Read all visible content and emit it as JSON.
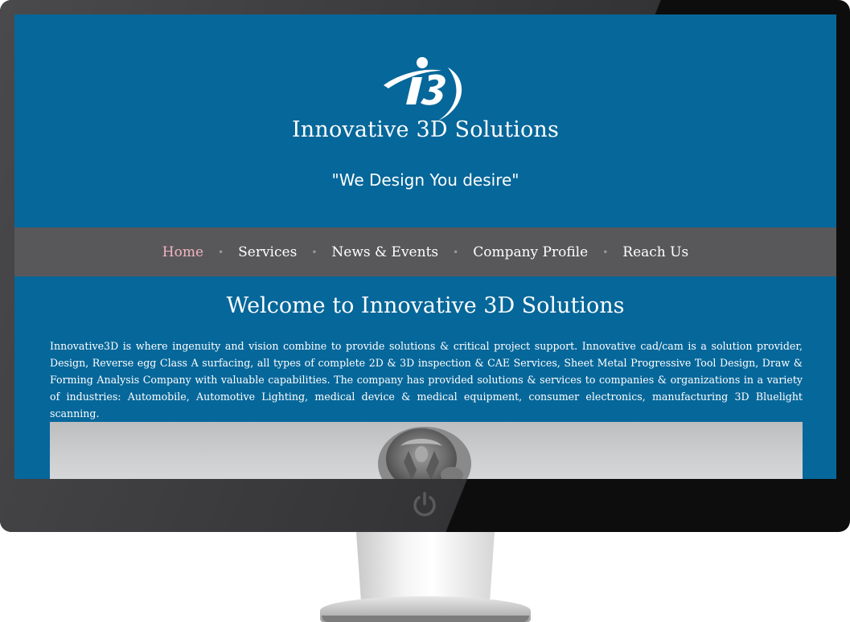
{
  "site": {
    "title": "Innovative 3D Solutions",
    "tagline": "\"We Design You desire\"",
    "logo_text": "i3"
  },
  "nav": {
    "items": [
      {
        "label": "Home",
        "active": true
      },
      {
        "label": "Services",
        "active": false
      },
      {
        "label": "News & Events",
        "active": false
      },
      {
        "label": "Company Profile",
        "active": false
      },
      {
        "label": "Reach Us",
        "active": false
      }
    ],
    "separator": "•"
  },
  "main": {
    "heading": "Welcome to Innovative 3D Solutions",
    "intro": "Innovative3D is where ingenuity and vision combine to provide solutions & critical project support. Innovative cad/cam is a solution provider, Design, Reverse egg Class A surfacing, all types of complete 2D & 3D inspection & CAE Services, Sheet Metal Progressive Tool Design, Draw & Forming Analysis Company with valuable capabilities. The company has provided solutions & services to companies & organizations in a variety of industries: Automobile, Automotive Lighting, medical device & medical equipment, consumer electronics, manufacturing 3D Bluelight scanning."
  },
  "colors": {
    "header_bg": "#06679a",
    "nav_bg": "#58585a",
    "nav_active": "#f2b3c2",
    "text": "#ffffff"
  },
  "icons": {
    "power": "power-icon",
    "logo": "i3-logo"
  }
}
